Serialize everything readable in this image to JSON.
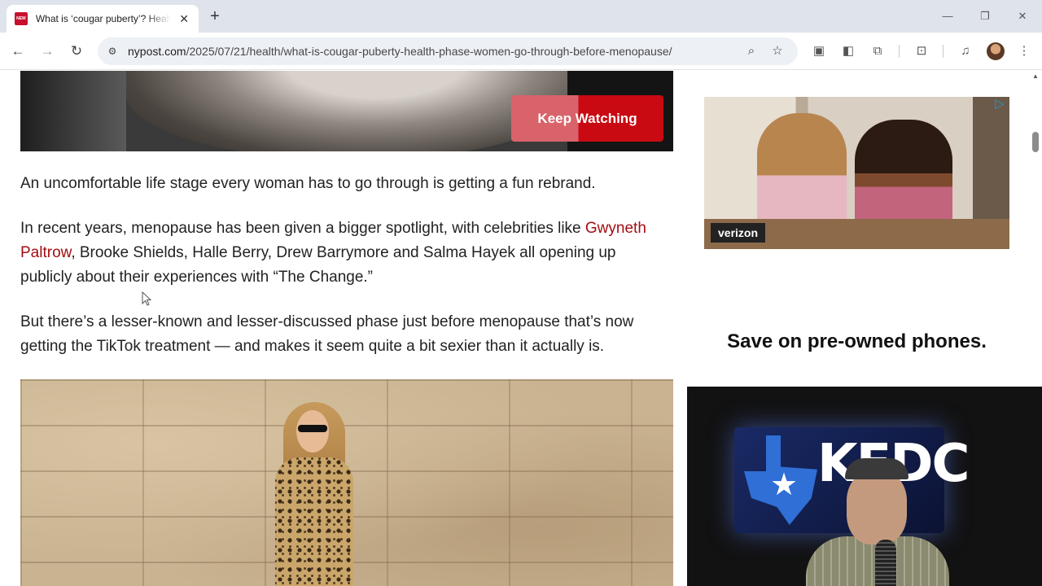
{
  "browser": {
    "tab": {
      "title": "What is ‘cougar puberty’? Health phase women go through before menopause",
      "favicon_label": "NEW YORK POST"
    },
    "url": {
      "domain": "nypost.com",
      "path": "/2025/07/21/health/what-is-cougar-puberty-health-phase-women-go-through-before-menopause/"
    },
    "icons": {
      "back": "back-arrow-icon",
      "forward": "forward-arrow-icon",
      "reload": "reload-icon",
      "site_info": "site-info-icon",
      "zoom": "zoom-icon",
      "bookmark": "star-icon",
      "new_tab": "plus-icon"
    }
  },
  "video": {
    "cta_label": "Keep Watching"
  },
  "article": {
    "p1": "An uncomfortable life stage every woman has to go through is getting a fun rebrand.",
    "p2_before": "In recent years, menopause has been given a bigger spotlight, with celebrities like ",
    "p2_link": "Gwyneth Paltrow",
    "p2_after": ", Brooke Shields, Halle Berry, Drew Barrymore and Salma Hayek all opening up publicly about their experiences with “The Change.”",
    "p3": "But there’s a lesser-known and lesser-discussed phase just before menopause that’s now getting the TikTok treatment — and makes it seem quite a bit sexier than it actually is."
  },
  "ad": {
    "brand": "verizon",
    "headline": "Save on pre-owned phones."
  },
  "webcam": {
    "sign_text": "KFDC"
  },
  "colors": {
    "link": "#a40d12",
    "cta_red": "#c90a12",
    "tabstrip": "#dfe3eb"
  }
}
